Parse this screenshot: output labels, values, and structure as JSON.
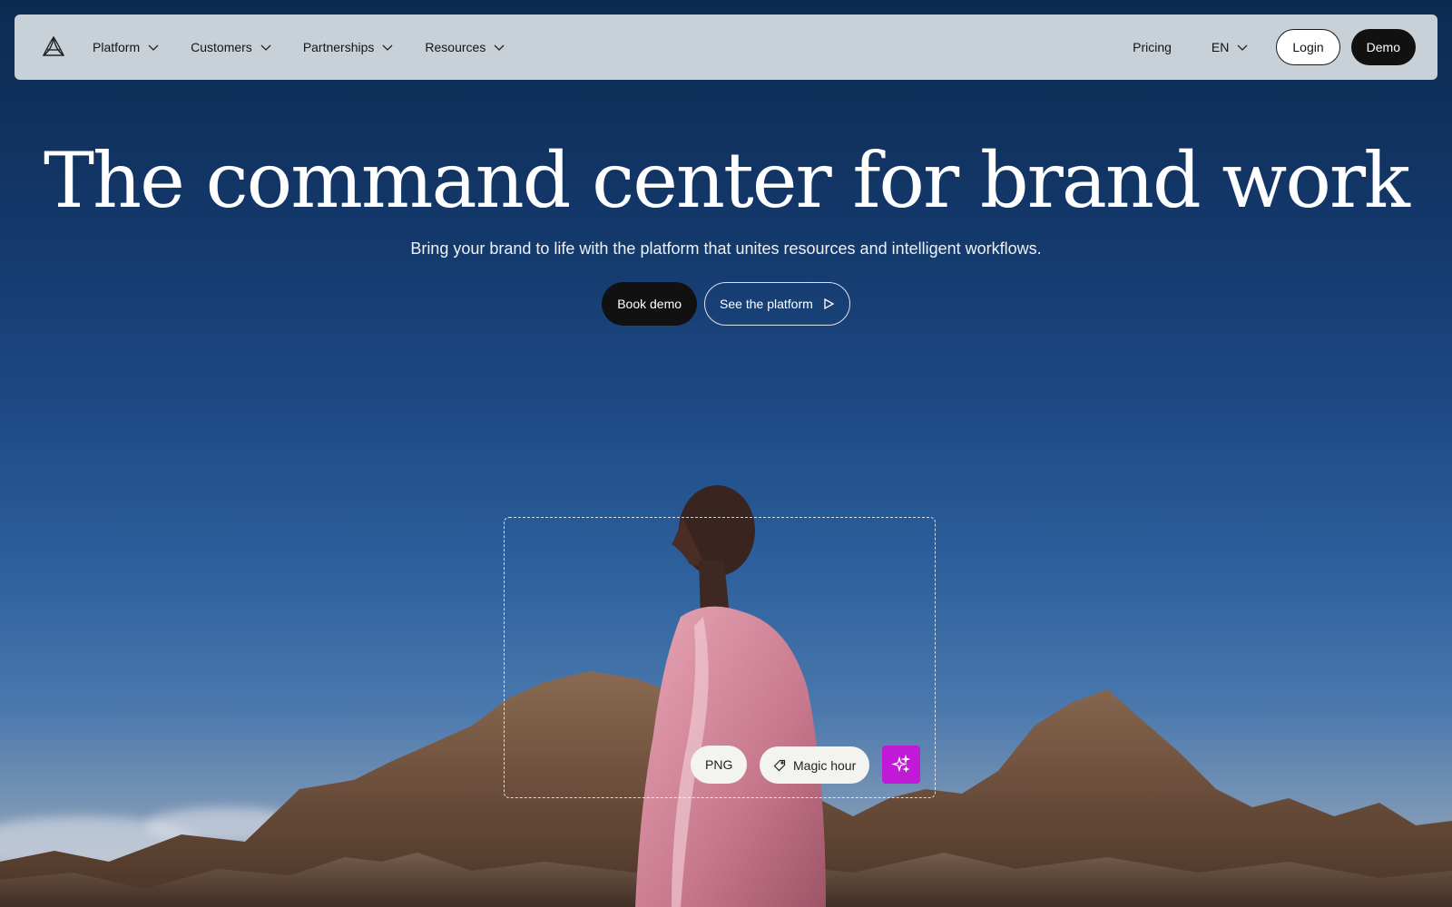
{
  "nav": {
    "logo_icon": "brand-logo-icon",
    "items": [
      {
        "label": "Platform",
        "icon": "chevron-down-icon"
      },
      {
        "label": "Customers",
        "icon": "chevron-down-icon"
      },
      {
        "label": "Partnerships",
        "icon": "chevron-down-icon"
      },
      {
        "label": "Resources",
        "icon": "chevron-down-icon"
      }
    ],
    "pricing": "Pricing",
    "language": "EN",
    "login": "Login",
    "demo": "Demo"
  },
  "hero": {
    "title": "The command center for brand work",
    "subtitle": "Bring your brand to life with the platform that unites resources and intelligent workflows.",
    "book_demo": "Book demo",
    "see_platform": "See the platform"
  },
  "asset_toolbar": {
    "format": "PNG",
    "tag": "Magic hour",
    "tag_icon": "tag-icon",
    "ai_icon": "sparkles-icon"
  },
  "colors": {
    "nav_bg": "#c8d0d8",
    "primary_button": "#111111",
    "ai_accent": "#c01ad6"
  }
}
